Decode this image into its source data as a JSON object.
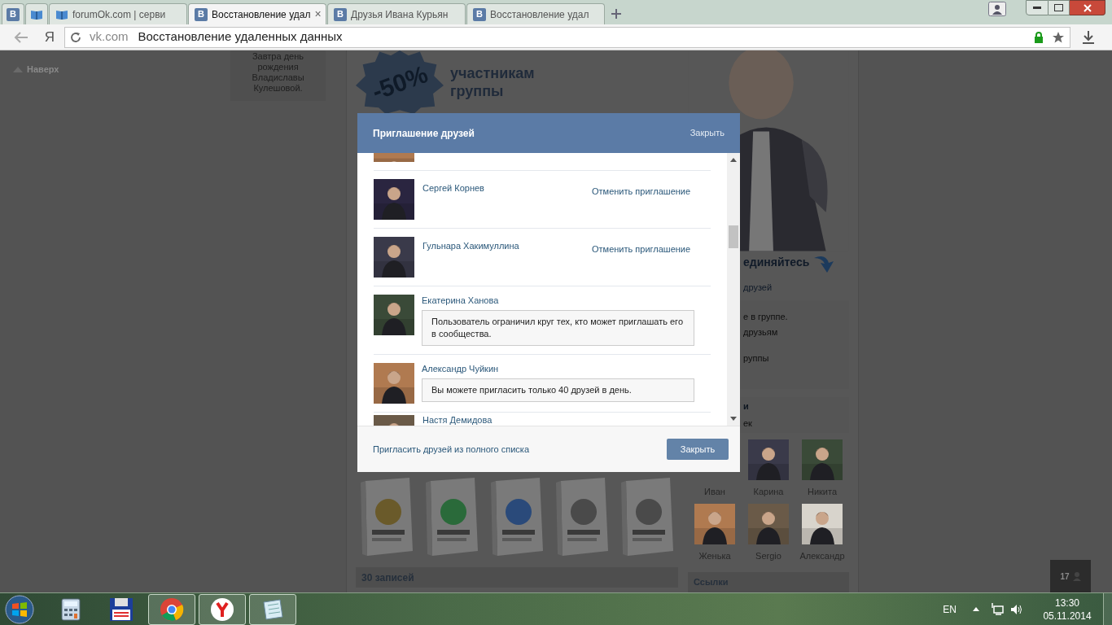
{
  "browser": {
    "tabs": [
      {
        "kind": "pinned",
        "favicon": "В",
        "selected": false
      },
      {
        "kind": "pinned",
        "selected": false
      },
      {
        "kind": "normal",
        "title": "forumOk.com | серви",
        "selected": false
      },
      {
        "kind": "normal",
        "favicon": "В",
        "title": "Восстановление удал",
        "close": "×",
        "selected": true
      },
      {
        "kind": "normal",
        "favicon": "В",
        "title": "Друзья Ивана Курьян",
        "selected": false
      },
      {
        "kind": "normal",
        "favicon": "В",
        "title": "Восстановление удал",
        "selected": false
      }
    ],
    "home": "Я",
    "domain": "vk.com",
    "page_title": "Восстановление удаленных данных"
  },
  "page": {
    "back_to_top": "Наверх",
    "birthday": "Завтра день рождения Владиславы Кулешовой.",
    "banner": {
      "discount": "-50%",
      "text": "участникам группы"
    },
    "right_fragments": {
      "join": "единяйтесь",
      "friends": "друзей",
      "block_lines": [
        "е в группе.",
        "друзьям",
        "руппы"
      ],
      "header": "и",
      "subheader": "ек"
    },
    "friends": [
      {
        "name": "Иван",
        "covered": true
      },
      {
        "name": "Карина",
        "covered": false
      },
      {
        "name": "Никита",
        "covered": false
      },
      {
        "name": "Женька",
        "covered": false
      },
      {
        "name": "Sergio",
        "covered": false
      },
      {
        "name": "Александр",
        "covered": false
      }
    ],
    "links_title": "Ссылки",
    "posts_title": "30 записей",
    "notifications": "17"
  },
  "dialog": {
    "title": "Приглашение друзей",
    "close_link": "Закрыть",
    "rows": [
      {
        "kind": "partial"
      },
      {
        "kind": "invited",
        "name": "Сергей Корнев",
        "action": "Отменить приглашение"
      },
      {
        "kind": "invited",
        "name": "Гульнара Хакимуллина",
        "action": "Отменить приглашение"
      },
      {
        "kind": "notice",
        "name": "Екатерина Ханова",
        "notice": "Пользователь ограничил круг тех, кто может приглашать его в сообщества."
      },
      {
        "kind": "notice",
        "name": "Александр Чуйкин",
        "notice": "Вы можете пригласить только 40 друзей в день."
      },
      {
        "kind": "cut",
        "name": "Настя Демидова"
      }
    ],
    "footer_link": "Пригласить друзей из полного списка",
    "button": "Закрыть"
  },
  "taskbar": {
    "apps": [
      {
        "kind": "calculator",
        "running": false
      },
      {
        "kind": "floppy",
        "running": false
      },
      {
        "kind": "chrome",
        "running": true
      },
      {
        "kind": "yandex",
        "running": true
      },
      {
        "kind": "notes",
        "running": true
      }
    ],
    "language": "EN",
    "time": "13:30",
    "date": "05.11.2014"
  }
}
